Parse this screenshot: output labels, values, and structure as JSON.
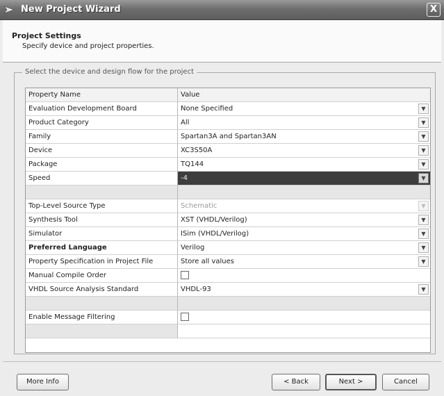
{
  "window": {
    "title": "New Project Wizard",
    "close_glyph": "X"
  },
  "header": {
    "title": "Project Settings",
    "subtitle": "Specify device and project properties."
  },
  "group_label": "Select the device and design flow for the project",
  "grid": {
    "columns": [
      "Property Name",
      "Value"
    ],
    "rows": [
      {
        "name": "Evaluation Development Board",
        "value": "None Specified"
      },
      {
        "name": "Product Category",
        "value": "All"
      },
      {
        "name": "Family",
        "value": "Spartan3A and Spartan3AN"
      },
      {
        "name": "Device",
        "value": "XC3S50A"
      },
      {
        "name": "Package",
        "value": "TQ144"
      },
      {
        "name": "Speed",
        "value": "-4"
      },
      {
        "name": "Top-Level Source Type",
        "value": "Schematic"
      },
      {
        "name": "Synthesis Tool",
        "value": "XST (VHDL/Verilog)"
      },
      {
        "name": "Simulator",
        "value": "ISim (VHDL/Verilog)"
      },
      {
        "name": "Preferred Language",
        "value": "Verilog"
      },
      {
        "name": "Property Specification in Project File",
        "value": "Store all values"
      },
      {
        "name": "Manual Compile Order",
        "value": ""
      },
      {
        "name": "VHDL Source Analysis Standard",
        "value": "VHDL-93"
      },
      {
        "name": "Enable Message Filtering",
        "value": ""
      }
    ]
  },
  "buttons": {
    "more_info": "More Info",
    "back": "< Back",
    "next": "Next >",
    "cancel": "Cancel"
  },
  "icons": {
    "dropdown": "chevron-down-icon",
    "app": "wizard-icon"
  },
  "colors": {
    "titlebar": "#6e6e6e",
    "selected_row": "#3d3d3d",
    "background": "#ececec"
  }
}
